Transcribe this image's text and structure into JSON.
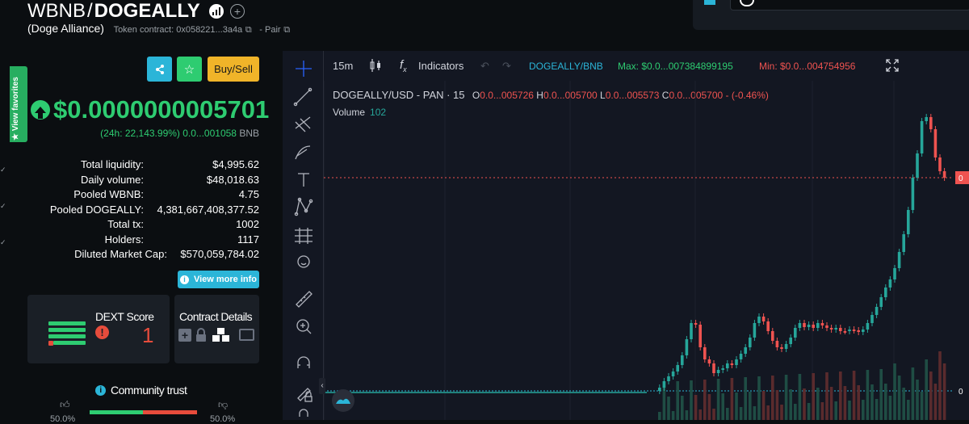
{
  "header": {
    "base_symbol": "WBNB",
    "separator": "/",
    "quote_symbol": "DOGEALLY",
    "token_name": "(Doge Alliance)",
    "contract_label": "Token contract: 0x058221...3a4a",
    "pair_label": "- Pair"
  },
  "sidebar": {
    "favorites_label": "★ View favorites"
  },
  "panel": {
    "buttons": {
      "buy_sell": "Buy/Sell",
      "view_more": "View more info"
    },
    "price": "$0.0000000005701",
    "change": "(24h: 22,143.99%) 0.0...001058",
    "change_unit": "BNB",
    "stats": [
      {
        "label": "Total liquidity:",
        "value": "$4,995.62"
      },
      {
        "label": "Daily volume:",
        "value": "$48,018.63"
      },
      {
        "label": "Pooled WBNB:",
        "value": "4.75"
      },
      {
        "label": "Pooled DOGEALLY:",
        "value": "4,381,667,408,377.52"
      },
      {
        "label": "Total tx:",
        "value": "1002"
      },
      {
        "label": "Holders:",
        "value": "1117"
      },
      {
        "label": "Diluted Market Cap:",
        "value": "$570,059,784.02"
      }
    ],
    "dext_title": "DEXT Score",
    "dext_score": "1",
    "contract_details": "Contract Details",
    "community_trust": "Community trust",
    "trust_left_pct": "50.0%",
    "trust_right_pct": "50.0%"
  },
  "chart": {
    "interval": "15m",
    "indicators_label": "Indicators",
    "pair": "DOGEALLY/BNB",
    "max_label": "Max: $0.0...007384899195",
    "min_label": "Min: $0.0...004754956",
    "legend_symbol": "DOGEALLY/USD - PAN · 15",
    "o_label": "O",
    "o_value": "0.0...005726",
    "h_label": "H",
    "h_value": "0.0...005700",
    "l_label": "L",
    "l_value": "0.0...005573",
    "c_label": "C",
    "c_value": "0.0...005700",
    "change": "- (-0.46%)",
    "volume_label": "Volume",
    "volume_value": "102",
    "axis_right_label": "0"
  },
  "colors": {
    "up": "#26a69a",
    "down": "#ef5350",
    "price_green": "#2ecc71",
    "buy_sell": "#f0b429",
    "share": "#2bb5d8",
    "star": "#2ecc71",
    "max_label": "#2ecc71",
    "min_label": "#ef5350",
    "pair_label": "#2bb5d8"
  }
}
